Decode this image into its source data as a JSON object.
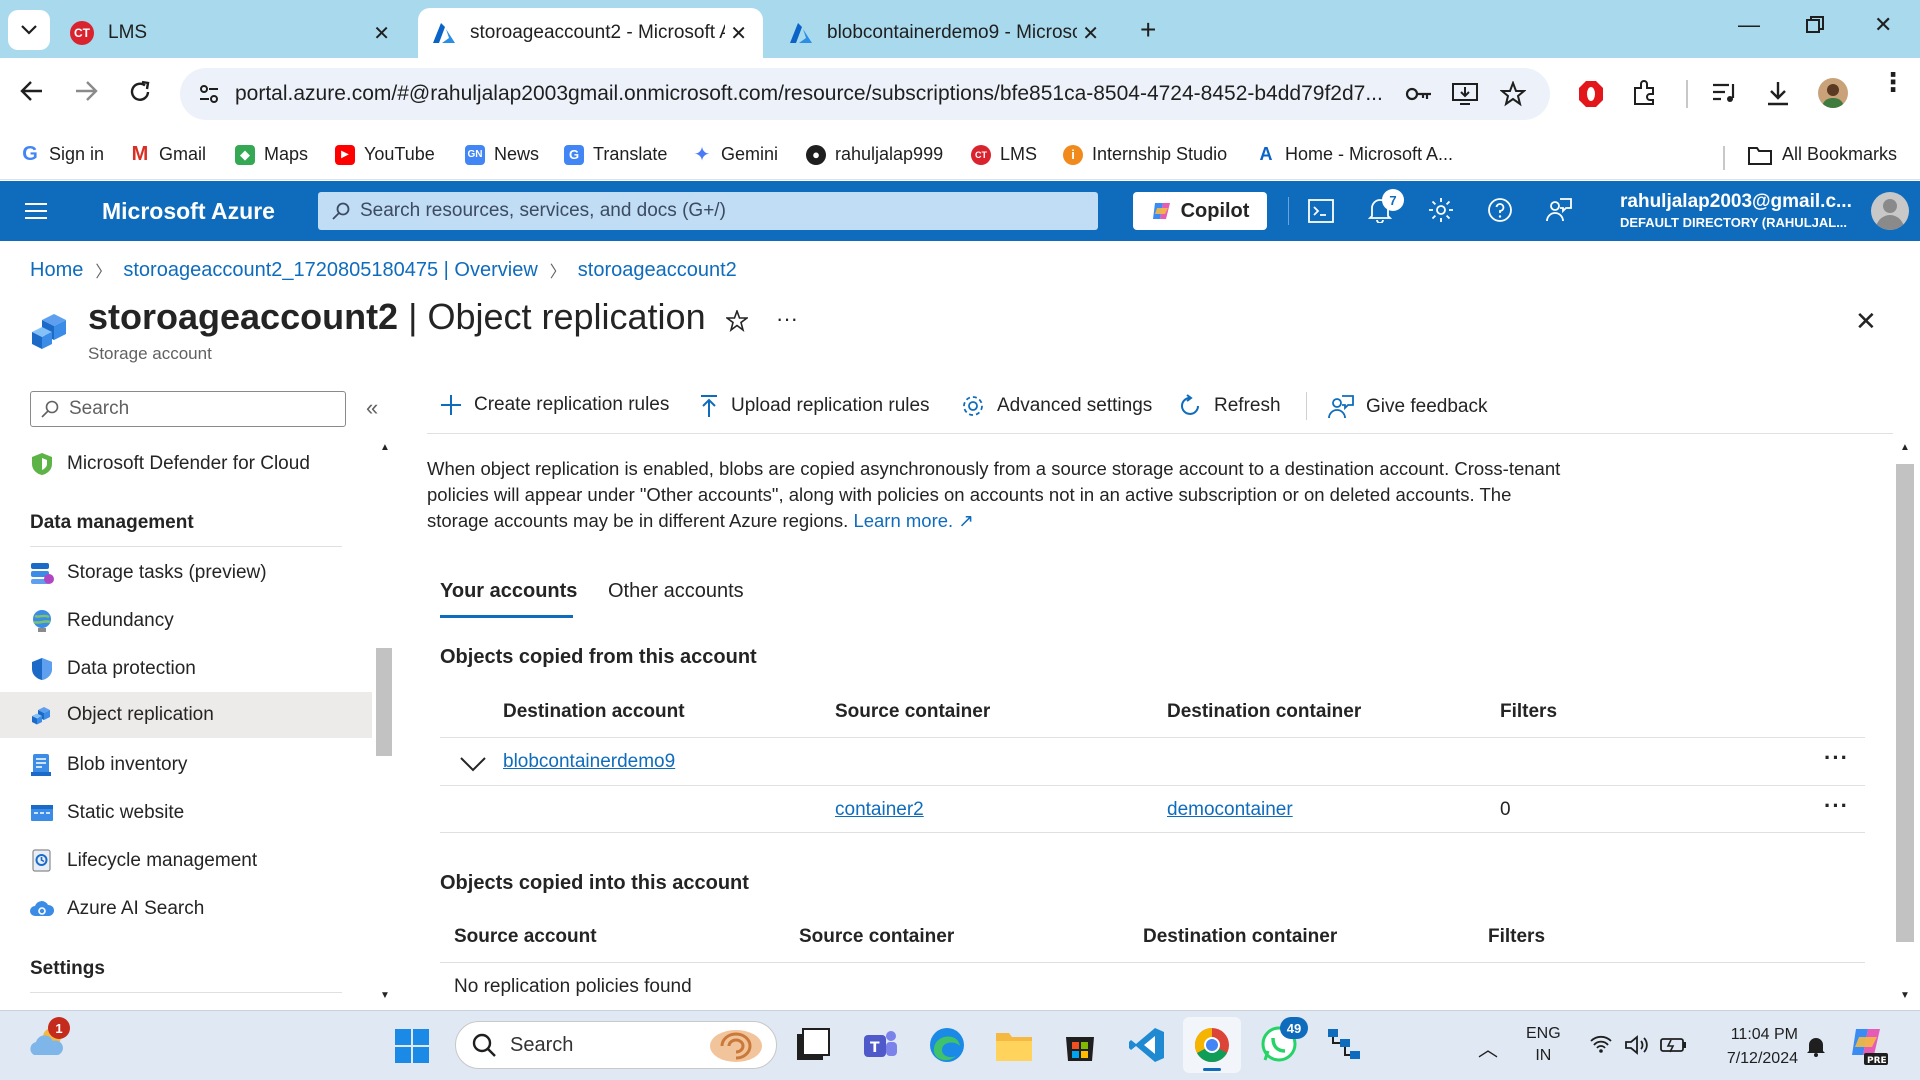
{
  "browser": {
    "tabs": [
      {
        "title": "LMS",
        "active": false
      },
      {
        "title": "storoageaccount2 - Microsoft A",
        "active": true
      },
      {
        "title": "blobcontainerdemo9 - Microso",
        "active": false
      }
    ],
    "url": "portal.azure.com/#@rahuljalap2003gmail.onmicrosoft.com/resource/subscriptions/bfe851ca-8504-4724-8452-b4dd79f2d7...",
    "bookmarks": [
      "Sign in",
      "Gmail",
      "Maps",
      "YouTube",
      "News",
      "Translate",
      "Gemini",
      "rahuljalap999",
      "LMS",
      "Internship Studio",
      "Home - Microsoft A..."
    ],
    "all_bookmarks": "All Bookmarks"
  },
  "azure": {
    "brand": "Microsoft Azure",
    "search_placeholder": "Search resources, services, and docs (G+/)",
    "copilot": "Copilot",
    "notifications_count": "7",
    "account_email": "rahuljalap2003@gmail.c...",
    "account_directory": "DEFAULT DIRECTORY (RAHULJAL..."
  },
  "breadcrumb": [
    "Home",
    "storoageaccount2_1720805180475 | Overview",
    "storoageaccount2"
  ],
  "page": {
    "resource_name": "storoageaccount2",
    "blade_title": "| Object replication",
    "subtitle": "Storage account"
  },
  "sidebar": {
    "search_placeholder": "Search",
    "top_item": "Microsoft Defender for Cloud",
    "section_data_management": "Data management",
    "items": [
      {
        "label": "Storage tasks (preview)",
        "icon": "storage-tasks-icon"
      },
      {
        "label": "Redundancy",
        "icon": "redundancy-icon"
      },
      {
        "label": "Data protection",
        "icon": "shield-icon"
      },
      {
        "label": "Object replication",
        "icon": "object-replication-icon"
      },
      {
        "label": "Blob inventory",
        "icon": "blob-inventory-icon"
      },
      {
        "label": "Static website",
        "icon": "static-website-icon"
      },
      {
        "label": "Lifecycle management",
        "icon": "lifecycle-icon"
      },
      {
        "label": "Azure AI Search",
        "icon": "cloud-search-icon"
      }
    ],
    "section_settings": "Settings"
  },
  "commands": {
    "create": "Create replication rules",
    "upload": "Upload replication rules",
    "advanced": "Advanced settings",
    "refresh": "Refresh",
    "feedback": "Give feedback"
  },
  "description": {
    "text": "When object replication is enabled, blobs are copied asynchronously from a source storage account to a destination account. Cross-tenant policies will appear under \"Other accounts\", along with policies on accounts not in an active subscription or on deleted accounts. The storage accounts may be in different Azure regions.",
    "learn_more": "Learn more."
  },
  "tabs": {
    "your_accounts": "Your accounts",
    "other_accounts": "Other accounts"
  },
  "copied_from": {
    "heading": "Objects copied from this account",
    "columns": [
      "Destination account",
      "Source container",
      "Destination container",
      "Filters"
    ],
    "group": "blobcontainerdemo9",
    "row": {
      "source_container": "container2",
      "destination_container": "democontainer",
      "filters": "0"
    }
  },
  "copied_into": {
    "heading": "Objects copied into this account",
    "columns": [
      "Source account",
      "Source container",
      "Destination container",
      "Filters"
    ],
    "empty": "No replication policies found"
  },
  "taskbar": {
    "search": "Search",
    "weather_badge": "1",
    "whatsapp_badge": "49",
    "lang1": "ENG",
    "lang2": "IN",
    "time": "11:04 PM",
    "date": "7/12/2024"
  }
}
